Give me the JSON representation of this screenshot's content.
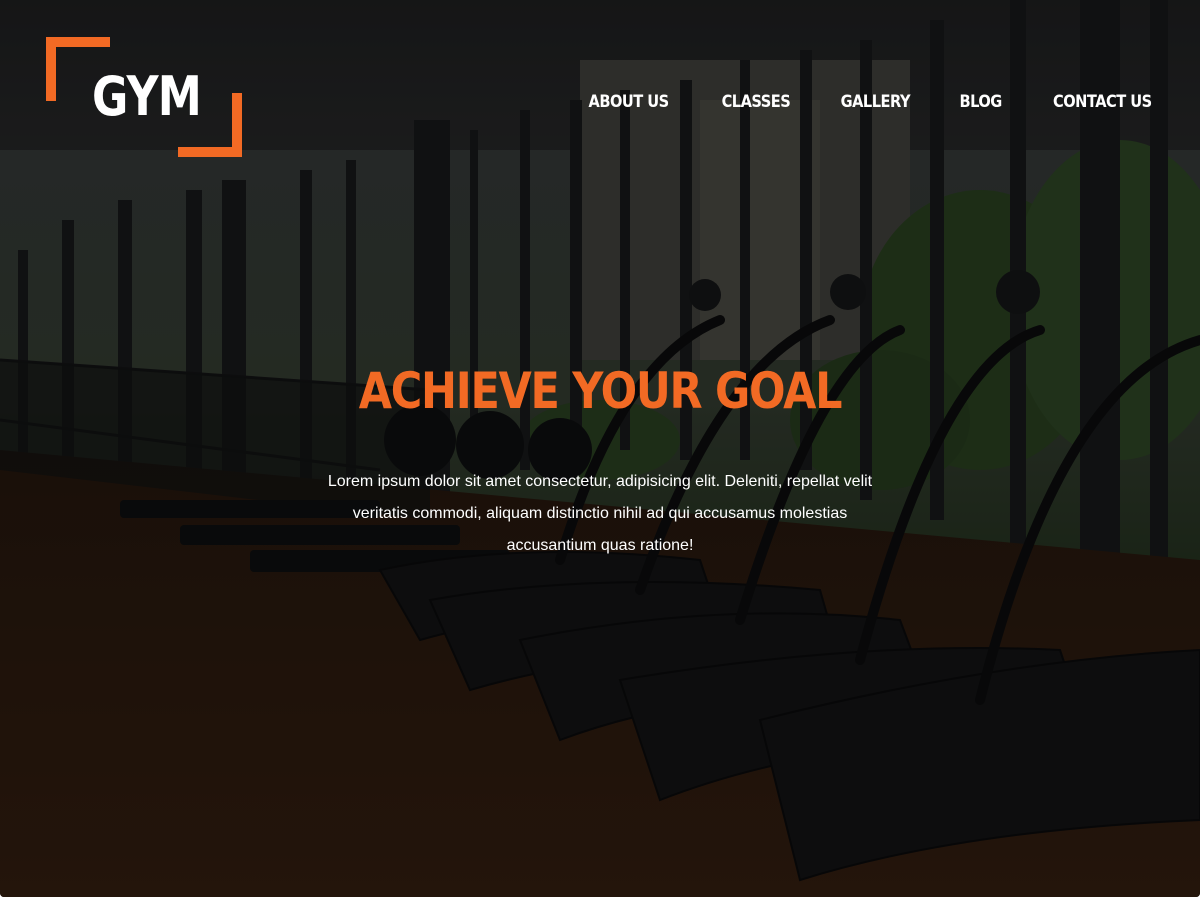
{
  "logo": {
    "text": "GYM",
    "accent_color": "#f26a24"
  },
  "nav": {
    "items": [
      {
        "label": "About Us"
      },
      {
        "label": "Classes"
      },
      {
        "label": "Gallery"
      },
      {
        "label": "Blog"
      },
      {
        "label": "Contact Us"
      }
    ]
  },
  "hero": {
    "title": "Achieve your goal",
    "title_color": "#f26a24",
    "text": "Lorem ipsum dolor sit amet consectetur, adipisicing elit. Deleniti, repellat velit veritatis commodi, aliquam distinctio nihil ad qui accusamus molestias accusantium quas ratione!",
    "background_image": "darkened photo of gym interior with curved treadmills and rowing machines by large windows"
  }
}
